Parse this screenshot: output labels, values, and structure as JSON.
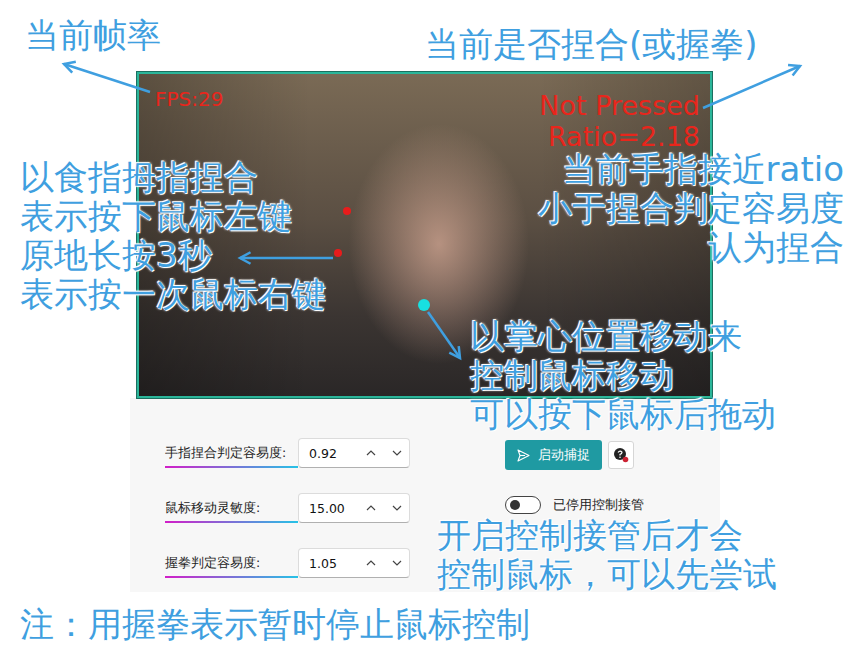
{
  "video": {
    "fps": "FPS:29",
    "status": "Not Pressed",
    "ratio": "Ratio=2.18"
  },
  "settings": [
    {
      "label": "手指捏合判定容易度:",
      "value": "0.92"
    },
    {
      "label": "鼠标移动灵敏度:",
      "value": "15.00"
    },
    {
      "label": "握拳判定容易度:",
      "value": "1.05"
    }
  ],
  "capture_button": {
    "label": "启动捕捉"
  },
  "control_toggle": {
    "label": "已停用控制接管",
    "on": false
  },
  "annotations": [
    {
      "lines": [
        "当前帧率"
      ]
    },
    {
      "lines": [
        "当前是否捏合(或握拳)"
      ]
    },
    {
      "lines": [
        "以食指拇指捏合",
        "表示按下鼠标左键",
        "原地长按3秒",
        "表示按一次鼠标右键"
      ]
    },
    {
      "lines": [
        "当前手指接近ratio",
        "小于捏合判定容易度",
        "认为捏合"
      ]
    },
    {
      "lines": [
        "以掌心位置移动来",
        "控制鼠标移动",
        "可以按下鼠标后拖动"
      ]
    },
    {
      "lines": [
        "开启控制接管后才会",
        "控制鼠标，可以先尝试"
      ]
    },
    {
      "lines": [
        "注：用握拳表示暂时停止鼠标控制"
      ]
    }
  ]
}
